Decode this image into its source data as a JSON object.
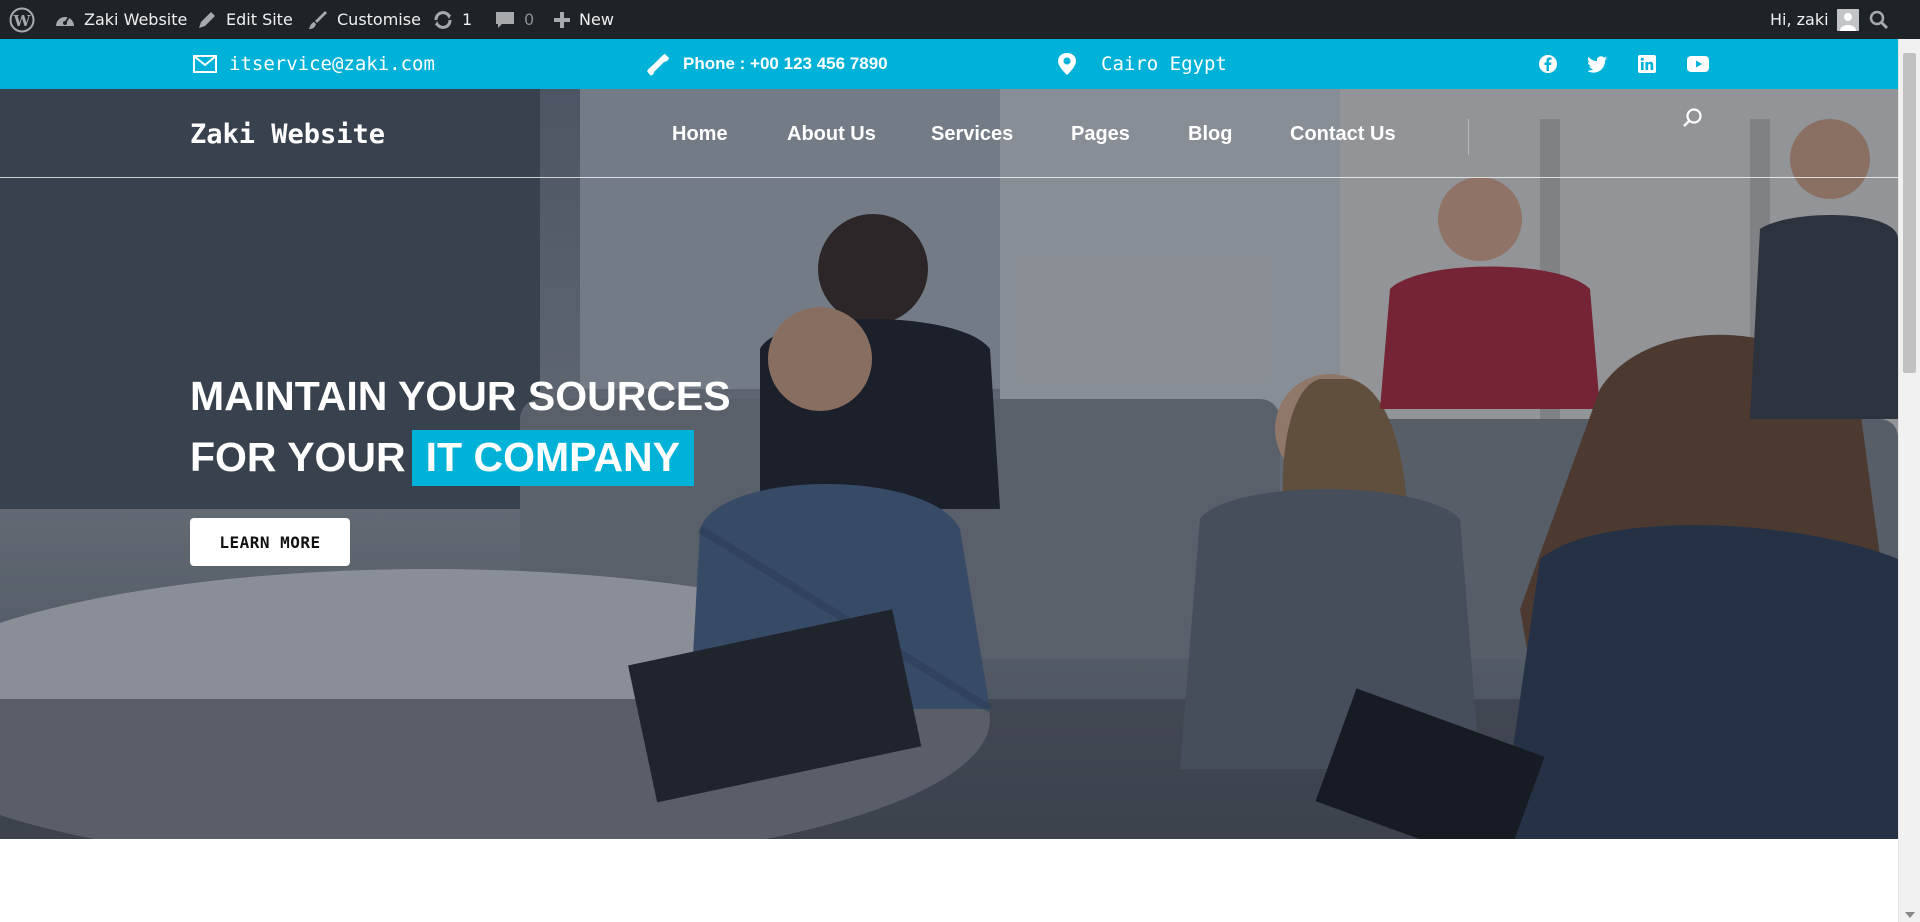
{
  "admin_bar": {
    "site_name": "Zaki Website",
    "edit_site": "Edit Site",
    "customise": "Customise",
    "updates_count": "1",
    "comments_count": "0",
    "new_label": "New",
    "greeting": "Hi, zaki"
  },
  "topbar": {
    "email": "itservice@zaki.com",
    "phone": "Phone : +00 123 456 7890",
    "location": "Cairo Egypt",
    "social_icons": [
      "facebook-icon",
      "twitter-icon",
      "linkedin-icon",
      "youtube-icon"
    ],
    "color": "#00b1d8"
  },
  "header": {
    "site_title": "Zaki Website",
    "nav": [
      "Home",
      "About Us",
      "Services",
      "Pages",
      "Blog",
      "Contact Us"
    ]
  },
  "hero": {
    "line1": "MAINTAIN YOUR SOURCES",
    "line2_prefix": "FOR YOUR",
    "line2_highlight": "IT COMPANY",
    "button": "LEARN MORE",
    "accent": "#00b1d8"
  }
}
